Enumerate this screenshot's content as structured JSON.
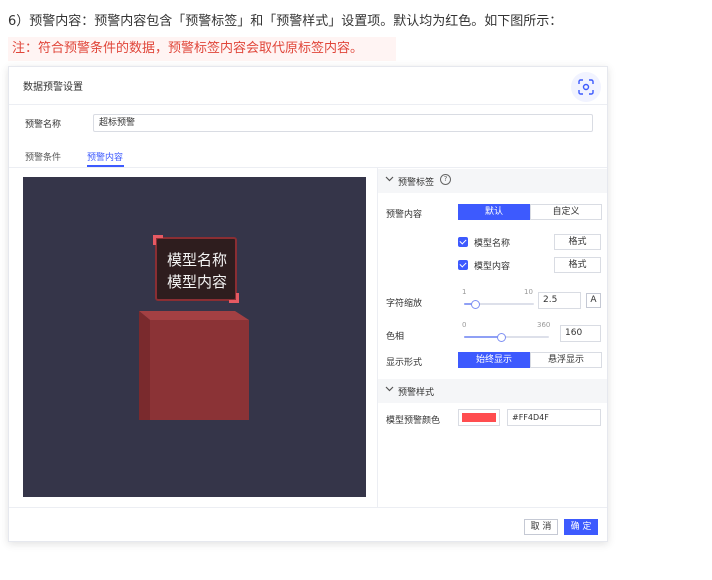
{
  "intro_text": "6）预警内容：预警内容包含「预警标签」和「预警样式」设置项。默认均为红色。如下图所示：",
  "note_text": "注：符合预警条件的数据，预警标签内容会取代原标签内容。",
  "dialog": {
    "title": "数据预警设置",
    "scan_icon": "scan-icon",
    "name_label": "预警名称",
    "name_value": "超标预警",
    "tabs": [
      {
        "label": "预警条件",
        "active": false
      },
      {
        "label": "预警内容",
        "active": true
      }
    ],
    "preview": {
      "background": "#353549",
      "tag_lines": [
        "模型名称",
        "模型内容"
      ],
      "box_color": "#8b3336"
    },
    "warning_label_section": {
      "title": "预警标签",
      "help_icon": "question-circle-icon",
      "content_label": "预警内容",
      "content_options": [
        "默认",
        "自定义"
      ],
      "content_selected": "默认",
      "checkboxes": [
        {
          "label": "模型名称",
          "checked": true,
          "button": "格式"
        },
        {
          "label": "模型内容",
          "checked": true,
          "button": "格式"
        }
      ],
      "font_scale": {
        "label": "字符缩放",
        "min": "1",
        "max": "10",
        "value": "2.5",
        "fraction": 0.17,
        "button": "A"
      },
      "hue": {
        "label": "色相",
        "min": "0",
        "max": "360",
        "value": "160",
        "fraction": 0.44
      },
      "display": {
        "label": "显示形式",
        "options": [
          "始终显示",
          "悬浮显示"
        ],
        "selected": "始终显示"
      }
    },
    "warning_style_section": {
      "title": "预警样式",
      "color_label": "模型预警颜色",
      "color_hex": "#FF4D4F",
      "swatch": "#ff4d4f"
    },
    "buttons": {
      "cancel": "取 消",
      "ok": "确 定"
    }
  }
}
